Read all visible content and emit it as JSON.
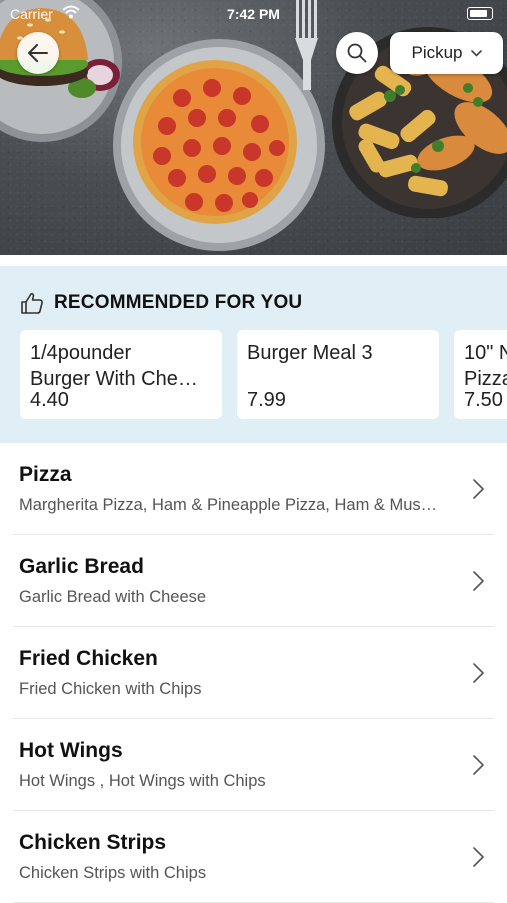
{
  "status_bar": {
    "carrier": "Carrier",
    "time": "7:42 PM"
  },
  "header": {
    "pickup_label": "Pickup"
  },
  "recommended": {
    "title": "RECOMMENDED FOR YOU",
    "items": [
      {
        "name": "1/4pounder\nBurger With Che…",
        "price": "4.40"
      },
      {
        "name": "Burger Meal 3",
        "price": "7.99"
      },
      {
        "name": "10\" N\nPizza",
        "price": "7.50"
      }
    ]
  },
  "categories": [
    {
      "name": "Pizza",
      "description": "Margherita Pizza, Ham & Pineapple Pizza, Ham & Mus…"
    },
    {
      "name": "Garlic Bread",
      "description": "Garlic Bread with Cheese"
    },
    {
      "name": "Fried Chicken",
      "description": "Fried Chicken with Chips"
    },
    {
      "name": "Hot Wings",
      "description": "Hot Wings , Hot Wings with Chips"
    },
    {
      "name": "Chicken Strips",
      "description": "Chicken Strips with Chips"
    }
  ],
  "colors": {
    "accent_bg": "#e0eef5",
    "hero_bg": "#4a4e52",
    "divider": "#e6e6e6"
  },
  "icons": [
    "back-arrow-icon",
    "search-icon",
    "chevron-down-icon",
    "thumbs-up-icon",
    "chevron-right-icon",
    "wifi-icon",
    "battery-icon"
  ]
}
